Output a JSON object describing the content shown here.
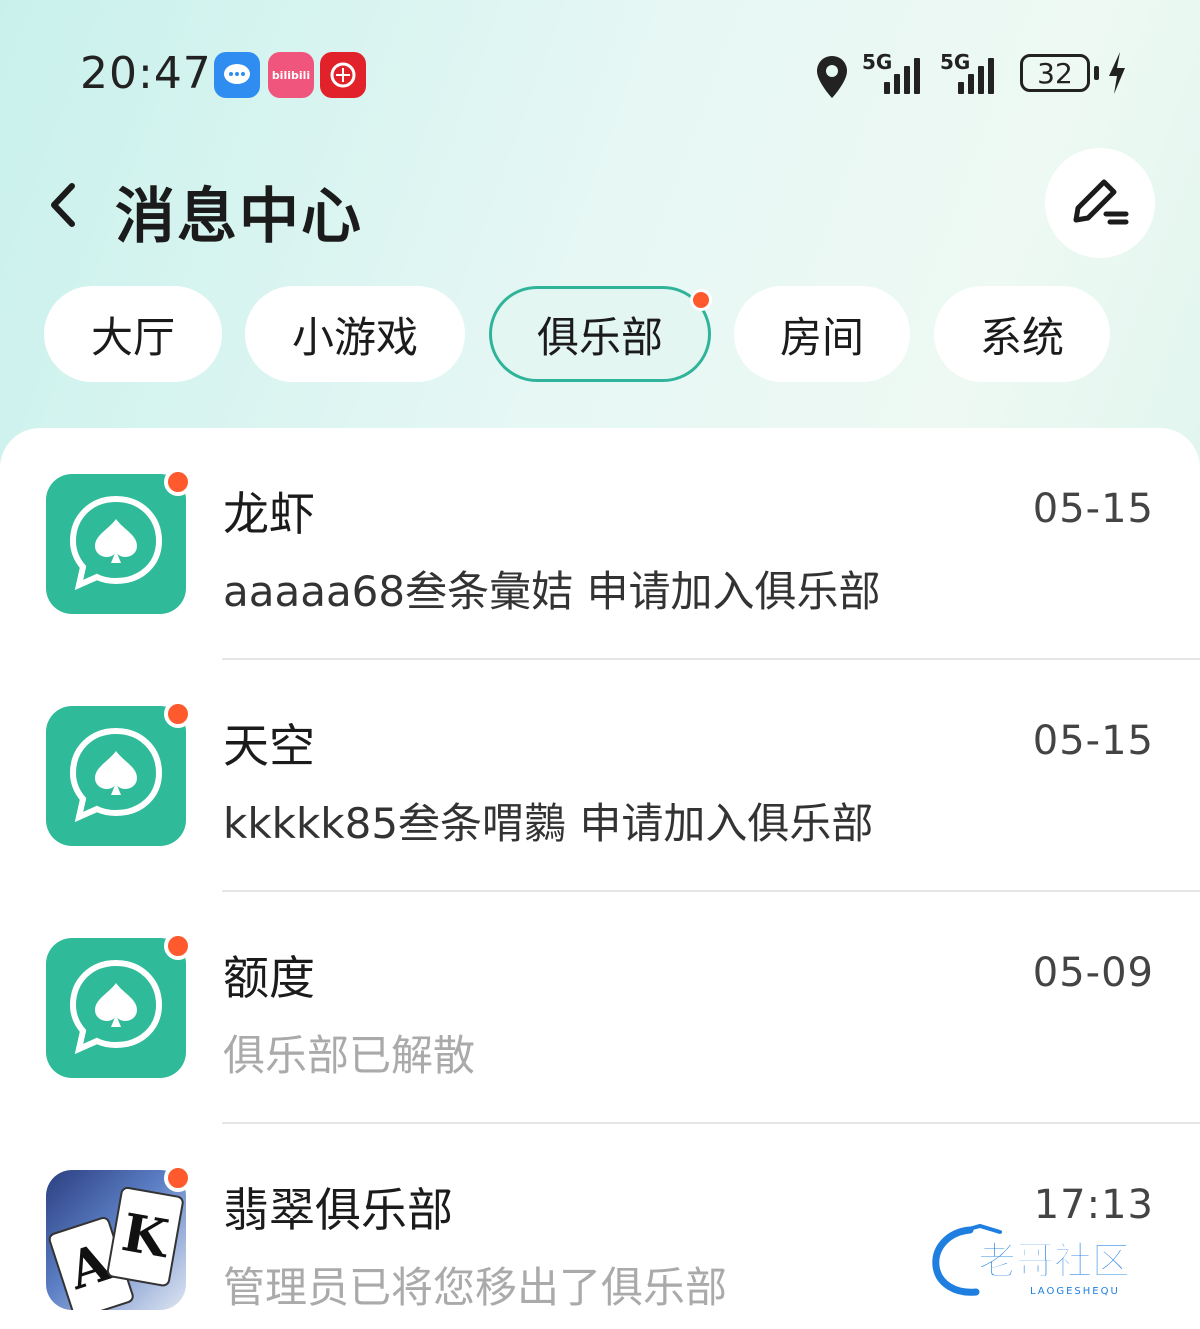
{
  "status_bar": {
    "time": "20:47",
    "apps": [
      {
        "name": "messages-app-icon",
        "label": ""
      },
      {
        "name": "bilibili-app-icon",
        "label": "bilibili"
      },
      {
        "name": "red-app-icon",
        "label": ""
      }
    ],
    "signal_1_label": "5G",
    "signal_2_label": "5G",
    "battery_level": "32"
  },
  "header": {
    "title": "消息中心"
  },
  "tabs": [
    {
      "label": "大厅",
      "active": false,
      "has_dot": false
    },
    {
      "label": "小游戏",
      "active": false,
      "has_dot": false
    },
    {
      "label": "俱乐部",
      "active": true,
      "has_dot": true
    },
    {
      "label": "房间",
      "active": false,
      "has_dot": false
    },
    {
      "label": "系统",
      "active": false,
      "has_dot": false
    }
  ],
  "messages": [
    {
      "title": "龙虾",
      "time": "05-15",
      "text": "aaaaa68叁条彙姞 申请加入俱乐部",
      "muted": false,
      "avatar": "spade-chat-icon",
      "unread": true
    },
    {
      "title": "天空",
      "time": "05-15",
      "text": "kkkkk85叁条喟鸏 申请加入俱乐部",
      "muted": false,
      "avatar": "spade-chat-icon",
      "unread": true
    },
    {
      "title": "额度",
      "time": "05-09",
      "text": "俱乐部已解散",
      "muted": true,
      "avatar": "spade-chat-icon",
      "unread": true
    },
    {
      "title": "翡翠俱乐部",
      "time": "17:13",
      "text": "管理员已将您移出了俱乐部",
      "muted": true,
      "avatar": "ace-king-cards-icon",
      "unread": true
    }
  ],
  "watermark": {
    "text": "老哥社区",
    "subtext": "LAOGESHEQU"
  },
  "colors": {
    "accent": "#2fba9a",
    "dot": "#ff5a2e"
  }
}
